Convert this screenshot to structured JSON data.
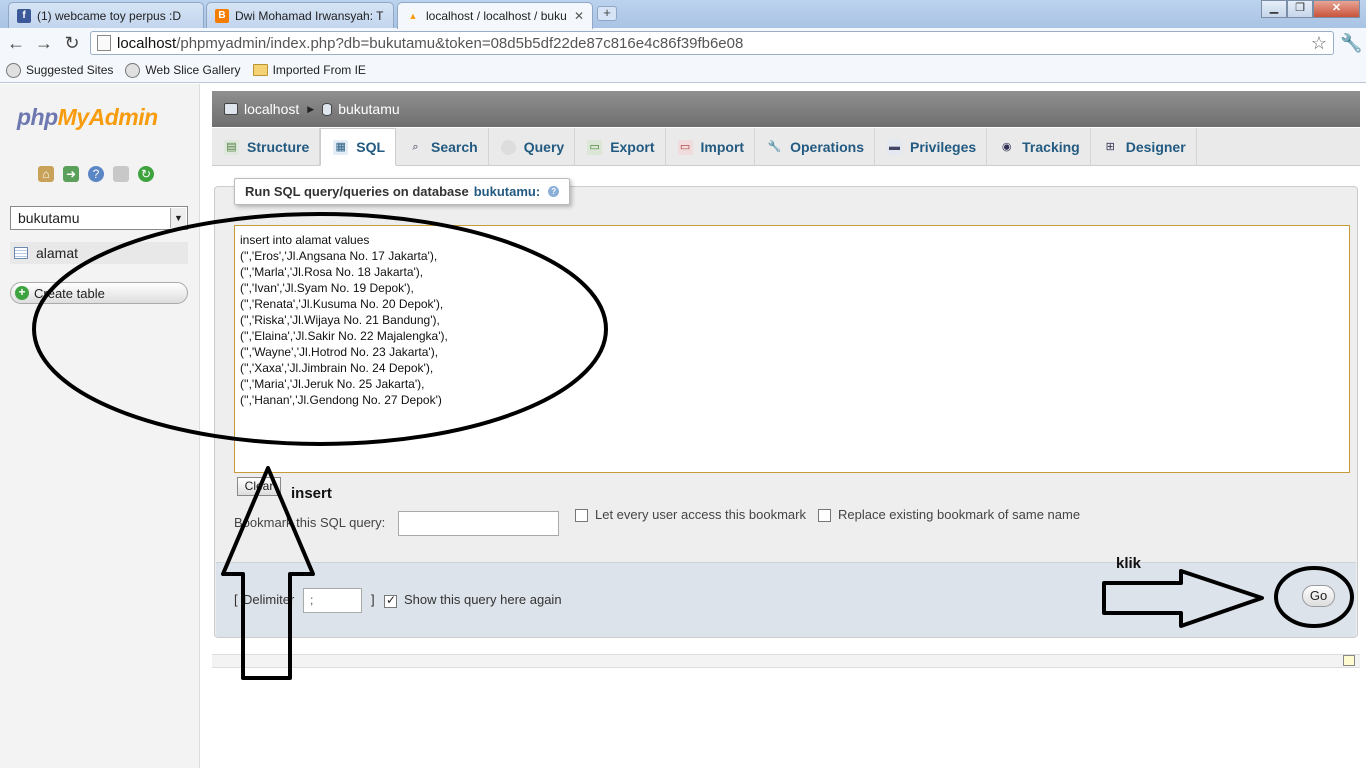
{
  "browser": {
    "tabs": [
      {
        "title": "(1) webcame toy perpus :D",
        "favicon": "facebook-icon",
        "color": "#3b5998",
        "active": false
      },
      {
        "title": "Dwi Mohamad Irwansyah: T",
        "favicon": "blogger-icon",
        "color": "#f57d00",
        "active": false
      },
      {
        "title": "localhost / localhost / buku",
        "favicon": "phpmyadmin-icon",
        "color": "#f89c0e",
        "active": true
      }
    ],
    "new_tab_label": "+",
    "window_buttons": {
      "minimize": "▁",
      "maximize": "❐",
      "close": "✕"
    },
    "address": {
      "host": "localhost",
      "path": "/phpmyadmin/index.php?db=bukutamu&token=08d5b5df22de87c816e4c86f39fb6e08"
    },
    "nav": {
      "back": "←",
      "forward": "→",
      "reload": "↻",
      "star": "☆",
      "wrench": "🔧"
    },
    "bookmarks": [
      "Suggested Sites",
      "Web Slice Gallery",
      "Imported From IE"
    ]
  },
  "sidebar": {
    "logo_php": "php",
    "logo_myadmin": "MyAdmin",
    "icons": [
      "home-icon",
      "logout-icon",
      "help-icon",
      "docs-icon",
      "reload-icon"
    ],
    "database_select": "bukutamu",
    "tables": [
      "alamat"
    ],
    "create_table": "Create table"
  },
  "breadcrumb": {
    "server": "localhost",
    "database": "bukutamu",
    "separator": "▶"
  },
  "tabs": [
    {
      "label": "Structure",
      "icon": "structure-icon",
      "active": false
    },
    {
      "label": "SQL",
      "icon": "sql-icon",
      "active": true
    },
    {
      "label": "Search",
      "icon": "search-icon",
      "active": false
    },
    {
      "label": "Query",
      "icon": "query-icon",
      "active": false
    },
    {
      "label": "Export",
      "icon": "export-icon",
      "active": false
    },
    {
      "label": "Import",
      "icon": "import-icon",
      "active": false
    },
    {
      "label": "Operations",
      "icon": "operations-icon",
      "active": false
    },
    {
      "label": "Privileges",
      "icon": "privileges-icon",
      "active": false
    },
    {
      "label": "Tracking",
      "icon": "tracking-icon",
      "active": false
    },
    {
      "label": "Designer",
      "icon": "designer-icon",
      "active": false
    }
  ],
  "sql_panel": {
    "legend_prefix": "Run SQL query/queries on database",
    "legend_db": "bukutamu:",
    "query": "insert into alamat values\n('','Eros','Jl.Angsana No. 17 Jakarta'),\n('','Marla','Jl.Rosa No. 18 Jakarta'),\n('','Ivan','Jl.Syam No. 19 Depok'),\n('','Renata','Jl.Kusuma No. 20 Depok'),\n('','Riska','Jl.Wijaya No. 21 Bandung'),\n('','Elaina','Jl.Sakir No. 22 Majalengka'),\n('','Wayne','Jl.Hotrod No. 23 Jakarta'),\n('','Xaxa','Jl.Jimbrain No. 24 Depok'),\n('','Maria','Jl.Jeruk No. 25 Jakarta'),\n('','Hanan','Jl.Gendong No. 27 Depok')",
    "clear_button": "Clear",
    "bookmark_label": "Bookmark this SQL query:",
    "bookmark_value": "",
    "let_every_user": "Let every user access this bookmark",
    "replace_existing": "Replace existing bookmark of same name",
    "delimiter_open": "[",
    "delimiter_label": "Delimiter",
    "delimiter_value": ";",
    "delimiter_close": "]",
    "show_query_again": "Show this query here again",
    "show_query_checked": true,
    "go_button": "Go"
  },
  "annotations": {
    "insert_label": "insert",
    "klik_label": "klik"
  },
  "colors": {
    "accent_link": "#235a81",
    "logo_php": "#6c78af",
    "logo_myadmin": "#f89c0e",
    "textarea_border": "#c69b3a"
  }
}
